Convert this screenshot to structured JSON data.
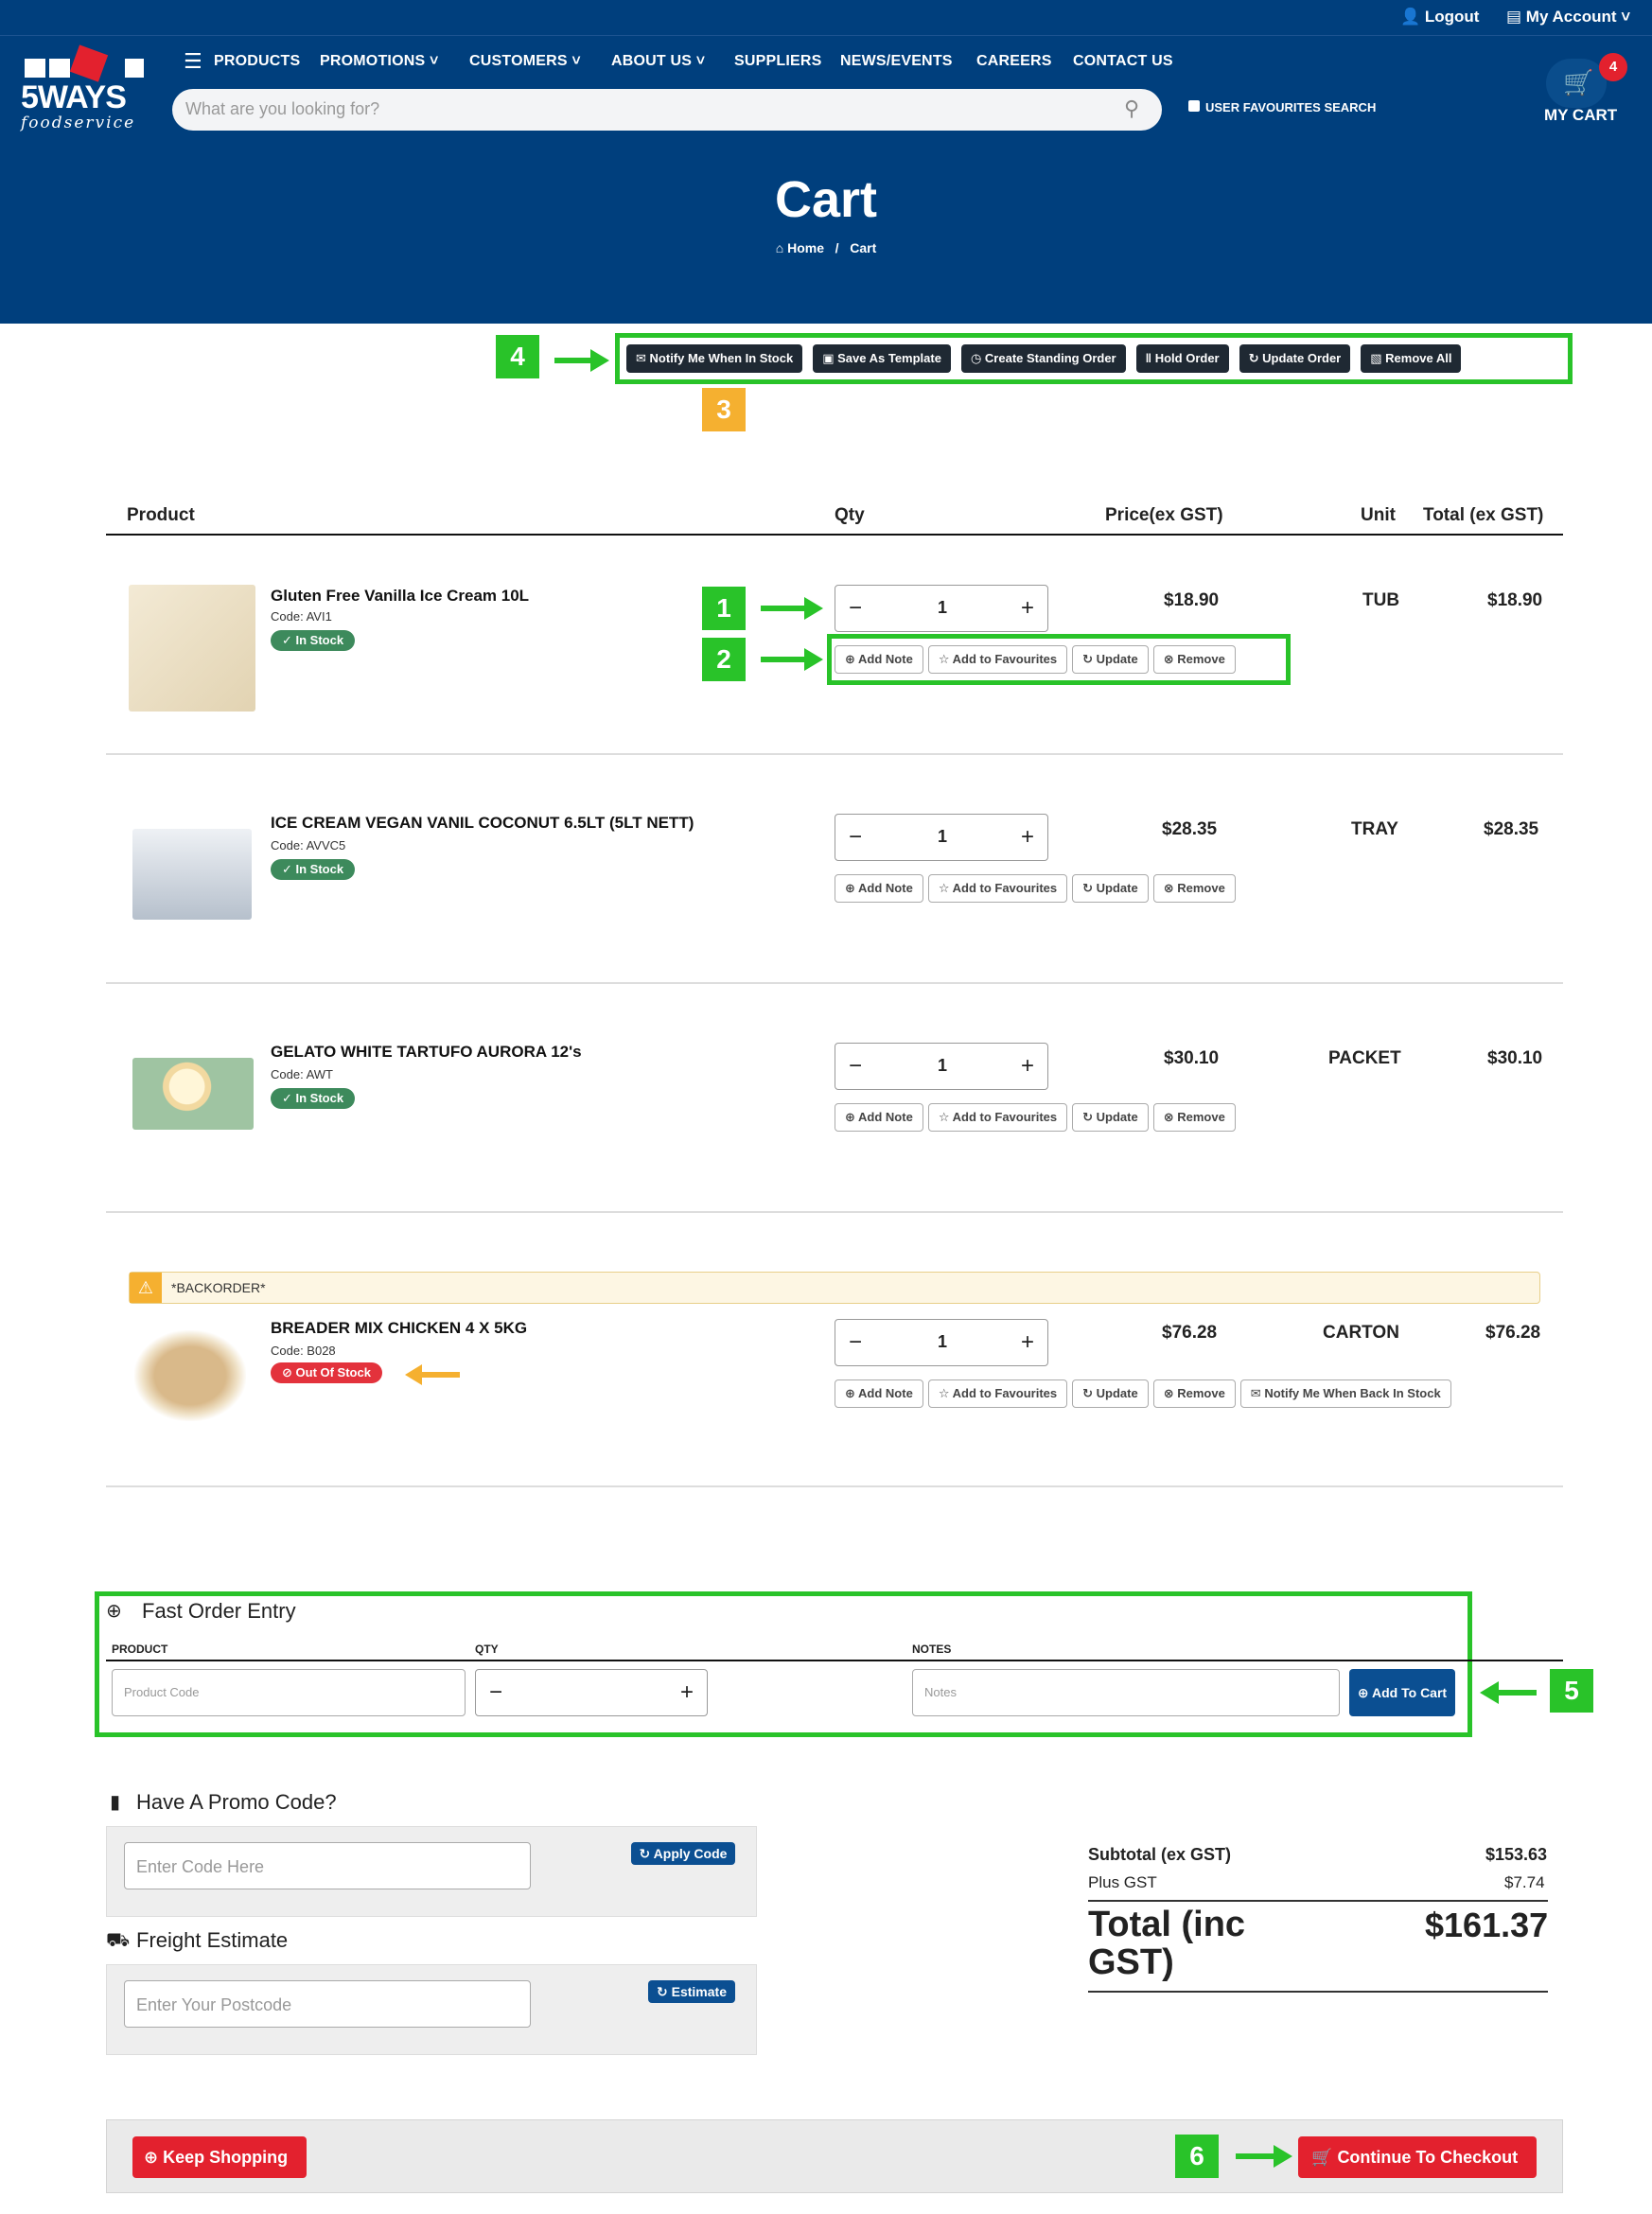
{
  "header": {
    "logout": "Logout",
    "my_account": "My Account",
    "logo_text": "5WAYS",
    "logo_sub": "foodservice",
    "nav": [
      "PRODUCTS",
      "PROMOTIONS",
      "CUSTOMERS",
      "ABOUT US",
      "SUPPLIERS",
      "NEWS/EVENTS",
      "CAREERS",
      "CONTACT US"
    ],
    "search_placeholder": "What are you looking for?",
    "favourites_search": "USER FAVOURITES SEARCH",
    "cart_count": "4",
    "cart_label": "MY CART",
    "page_title": "Cart",
    "breadcrumb": [
      "Home",
      "Cart"
    ]
  },
  "toolbar": [
    "Notify Me When In Stock",
    "Save As Template",
    "Create Standing Order",
    "Hold Order",
    "Update Order",
    "Remove All"
  ],
  "annotations": {
    "n1": "1",
    "n2": "2",
    "n3": "3",
    "n4": "4",
    "n5": "5",
    "n6": "6"
  },
  "table_headers": {
    "product": "Product",
    "qty": "Qty",
    "price": "Price(ex GST)",
    "unit": "Unit",
    "total": "Total (ex GST)"
  },
  "row_actions": [
    "Add Note",
    "Add to Favourites",
    "Update",
    "Remove"
  ],
  "backorder_action": "Notify Me When Back In Stock",
  "items": [
    {
      "name": "Gluten Free Vanilla Ice Cream 10L",
      "code": "Code: AVI1",
      "stock": "In Stock",
      "qty": "1",
      "price": "$18.90",
      "unit": "TUB",
      "total": "$18.90"
    },
    {
      "name": "ICE CREAM VEGAN VANIL COCONUT 6.5LT (5LT NETT)",
      "code": "Code: AVVC5",
      "stock": "In Stock",
      "qty": "1",
      "price": "$28.35",
      "unit": "TRAY",
      "total": "$28.35"
    },
    {
      "name": "GELATO WHITE TARTUFO AURORA 12's",
      "code": "Code: AWT",
      "stock": "In Stock",
      "qty": "1",
      "price": "$30.10",
      "unit": "PACKET",
      "total": "$30.10"
    },
    {
      "name": "BREADER MIX CHICKEN 4 X 5KG",
      "code": "Code: B028",
      "stock": "Out Of Stock",
      "qty": "1",
      "price": "$76.28",
      "unit": "CARTON",
      "total": "$76.28",
      "backorder": "*BACKORDER*"
    }
  ],
  "fast_order": {
    "title": "Fast Order Entry",
    "col_product": "PRODUCT",
    "col_qty": "QTY",
    "col_notes": "NOTES",
    "product_placeholder": "Product Code",
    "notes_placeholder": "Notes",
    "add_to_cart": "Add To Cart"
  },
  "promo": {
    "title": "Have A Promo Code?",
    "placeholder": "Enter Code Here",
    "button": "Apply Code"
  },
  "freight": {
    "title": "Freight Estimate",
    "placeholder": "Enter Your Postcode",
    "button": "Estimate"
  },
  "totals": {
    "subtotal_label": "Subtotal (ex GST)",
    "subtotal": "$153.63",
    "gst_label": "Plus GST",
    "gst": "$7.74",
    "total_label": "Total (inc GST)",
    "total": "$161.37"
  },
  "footer": {
    "keep_shopping": "Keep Shopping",
    "checkout": "Continue To Checkout"
  },
  "colors": {
    "header_bg": "#003f7d",
    "highlight": "#29c329",
    "orange": "#f5b030",
    "red": "#e3212e"
  }
}
